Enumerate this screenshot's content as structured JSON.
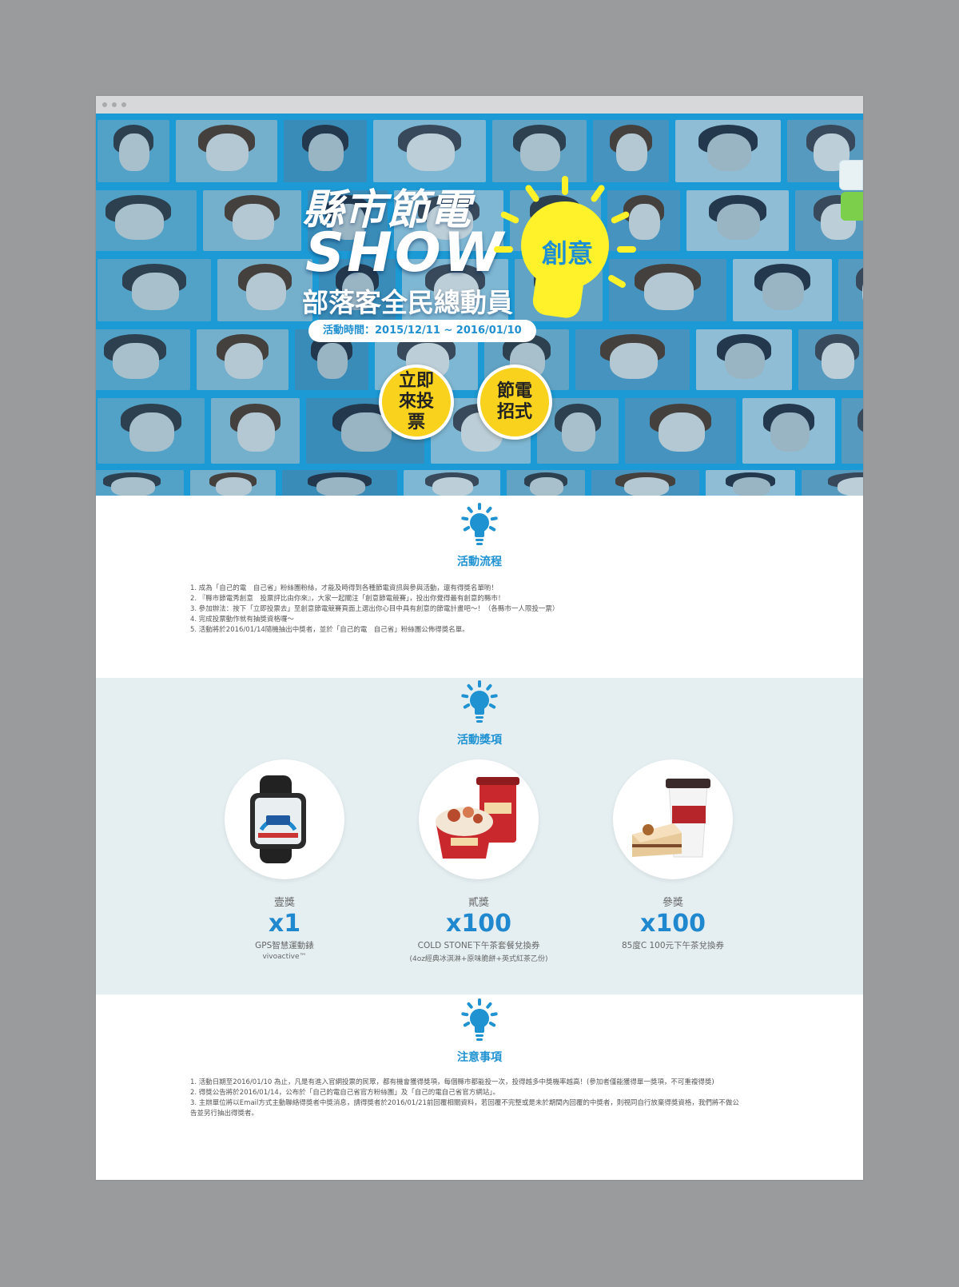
{
  "hero": {
    "title_line1": "縣市節電",
    "title_line2": "SHOW",
    "title_line3": "部落客全民總動員",
    "bulb_label": "創意",
    "date_range": "活動時間：2015/12/11 ~ 2016/01/10",
    "vote_button": "立即來投票",
    "tips_button": "節電招式",
    "accent_color": "#1d9fd8",
    "bulb_color": "#fff22b"
  },
  "process": {
    "title": "活動流程",
    "items": [
      "1. 成為「自己的電　自己省」粉絲團粉絲，才能及時得到各種節電資訊與參與活動，還有得獎名單喲！",
      "2. 『縣市節電秀創意　投票評比由你來』，大家一起關注「創意節電競賽」，投出你覺得最有創意的縣市！",
      "3. 參加辦法：按下「立即投票去」至創意節電競賽頁面上選出你心目中具有創意的節電計畫吧～！（各縣市一人限投一票）",
      "4. 完成投票動作就有抽獎資格囉～",
      "5. 活動將於2016/01/14隨機抽出中獎者，並於「自己的電　自己省」粉絲團公佈得獎名單。"
    ]
  },
  "prizes": {
    "title": "活動獎項",
    "items": [
      {
        "rank": "壹獎",
        "qty": "x1",
        "name": "GPS智慧運動錶",
        "sub": "vivoactive™",
        "icon": "watch-icon"
      },
      {
        "rank": "貳獎",
        "qty": "x100",
        "name": "COLD STONE下午茶套餐兌換券",
        "sub": "(4oz經典冰淇淋+原味脆餅+英式紅茶乙份)",
        "icon": "ice-cream-icon"
      },
      {
        "rank": "參獎",
        "qty": "x100",
        "name": "85度C 100元下午茶兌換券",
        "sub": "",
        "icon": "cake-coffee-icon"
      }
    ]
  },
  "notes": {
    "title": "注意事項",
    "items": [
      "1. 活動日期至2016/01/10 為止，凡是有進入官網投票的民眾，都有機會獲得獎項，每個縣市都能投一次，投得越多中獎機率越高！(參加者僅能獲得單一獎項，不可重複得獎)",
      "2. 得獎公告將於2016/01/14，公布於「自己的電自己省官方粉絲團」及「自己的電自己省官方網站」。",
      "3. 主辦單位將以Email方式主動聯絡得獎者中獎消息，請得獎者於2016/01/21前回覆相關資料，若回覆不完整或是未於期間內回覆的中獎者，則視同自行放棄得獎資格，我們將不做公告並另行抽出得獎者。"
    ]
  }
}
